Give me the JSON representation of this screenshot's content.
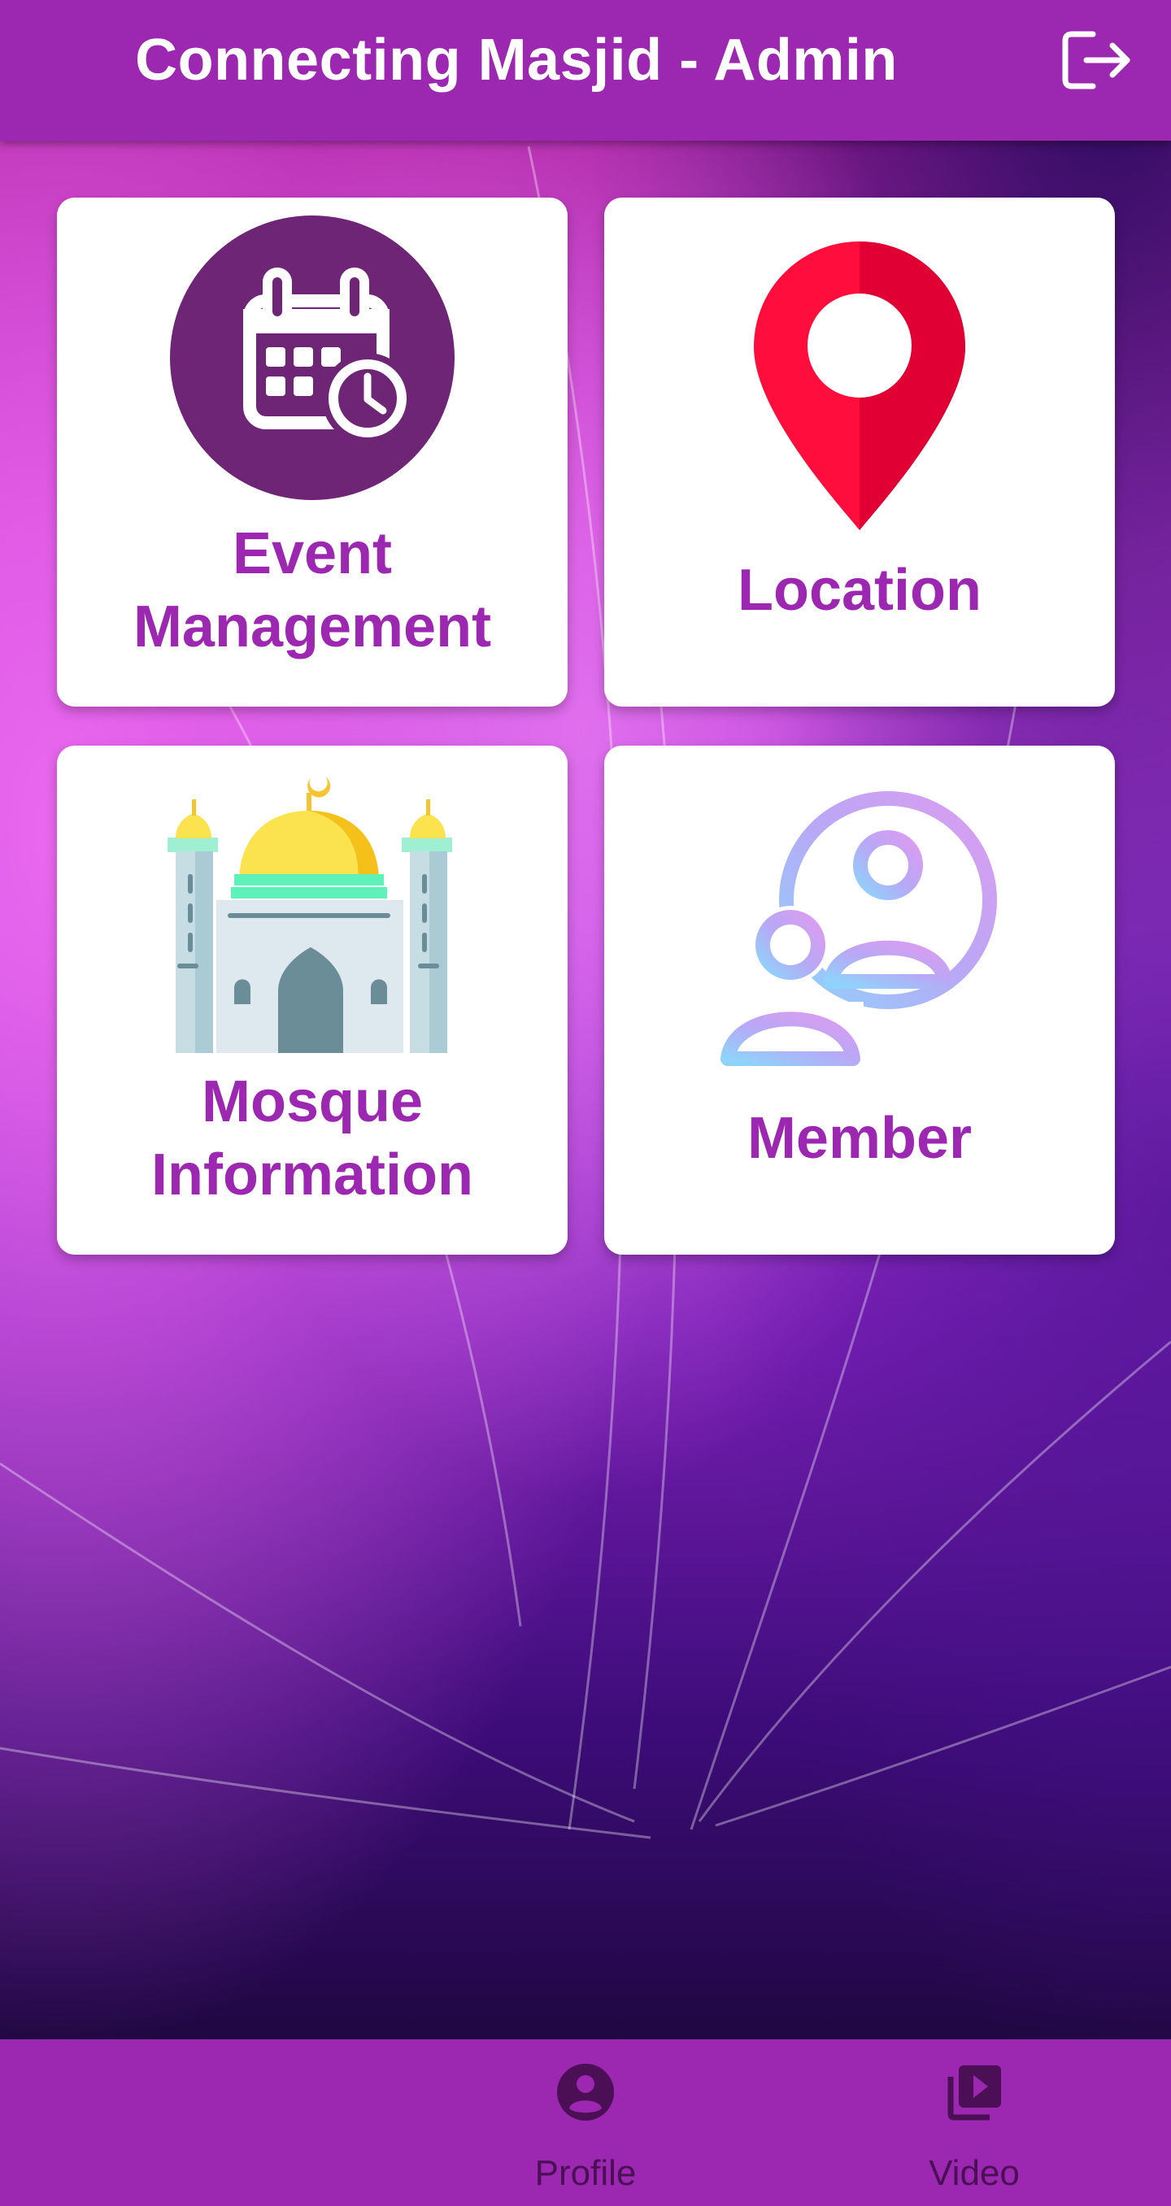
{
  "app": {
    "title": "Connecting Masjid - Admin",
    "logout_icon": "logout-icon"
  },
  "menu": {
    "cards": [
      {
        "name": "event-management",
        "label_lines": [
          "Event",
          "Management"
        ],
        "icon": "calendar-clock-icon"
      },
      {
        "name": "location",
        "label_lines": [
          "Location"
        ],
        "icon": "map-pin-icon"
      },
      {
        "name": "mosque-information",
        "label_lines": [
          "Mosque",
          "Information"
        ],
        "icon": "mosque-icon"
      },
      {
        "name": "member",
        "label_lines": [
          "Member"
        ],
        "icon": "members-icon"
      }
    ]
  },
  "bottom_nav": {
    "items": [
      {
        "label": "Profile",
        "icon": "account-circle-icon"
      },
      {
        "label": "Video",
        "icon": "video-library-icon"
      }
    ]
  },
  "colors": {
    "app_bar": "#9c27b0",
    "card_label": "#9c27b0",
    "nav_label": "#4a0f55",
    "card_background": "#ffffff"
  }
}
